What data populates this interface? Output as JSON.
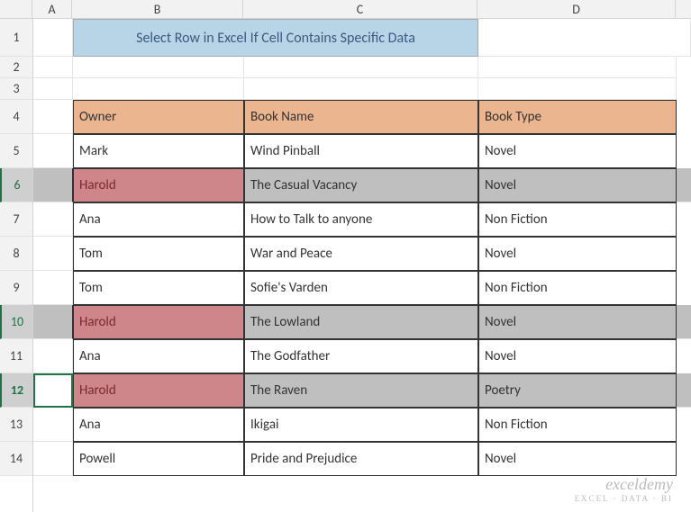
{
  "columns": [
    "A",
    "B",
    "C",
    "D"
  ],
  "title": "Select Row in Excel If Cell Contains Specific Data",
  "headers": {
    "owner": "Owner",
    "book_name": "Book Name",
    "book_type": "Book Type"
  },
  "chart_data": {
    "type": "table",
    "columns": [
      "Owner",
      "Book Name",
      "Book Type"
    ],
    "rows": [
      {
        "owner": "Mark",
        "book_name": "Wind Pinball",
        "book_type": "Novel",
        "highlighted": false
      },
      {
        "owner": "Harold",
        "book_name": "The Casual Vacancy",
        "book_type": "Novel",
        "highlighted": true
      },
      {
        "owner": "Ana",
        "book_name": "How to Talk to anyone",
        "book_type": "Non Fiction",
        "highlighted": false
      },
      {
        "owner": "Tom",
        "book_name": "War and Peace",
        "book_type": "Novel",
        "highlighted": false
      },
      {
        "owner": "Tom",
        "book_name": "Sofie's Varden",
        "book_type": "Non Fiction",
        "highlighted": false
      },
      {
        "owner": "Harold",
        "book_name": "The Lowland",
        "book_type": "Novel",
        "highlighted": true
      },
      {
        "owner": "Ana",
        "book_name": "The Godfather",
        "book_type": "Novel",
        "highlighted": false
      },
      {
        "owner": "Harold",
        "book_name": "The Raven",
        "book_type": "Poetry",
        "highlighted": true
      },
      {
        "owner": "Ana",
        "book_name": "Ikigai",
        "book_type": "Non Fiction",
        "highlighted": false
      },
      {
        "owner": "Powell",
        "book_name": "Pride and Prejudice",
        "book_type": "Novel",
        "highlighted": false
      }
    ]
  },
  "selected_rows": [
    6,
    10,
    12
  ],
  "active_row": 12,
  "active_cell": "A12",
  "watermark": {
    "main": "exceldemy",
    "sub": "EXCEL · DATA · BI"
  }
}
